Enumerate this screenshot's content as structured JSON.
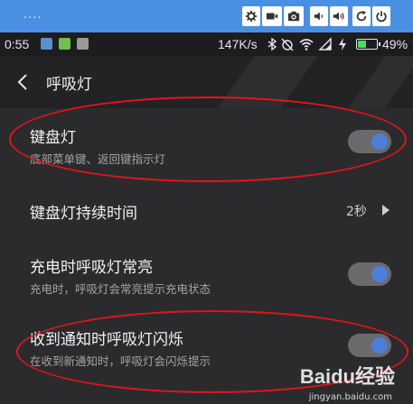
{
  "emulator": {
    "label": "....",
    "buttons": [
      "gear-icon",
      "video-icon",
      "camera-icon",
      "volume-down-icon",
      "volume-up-icon",
      "refresh-icon",
      "power-icon"
    ]
  },
  "status_bar": {
    "time": "0:55",
    "speed": "147K/s",
    "battery_percent": "49%",
    "battery_level": 0.49
  },
  "header": {
    "title": "呼吸灯"
  },
  "settings": {
    "keyboard_light": {
      "title": "键盘灯",
      "subtitle": "底部菜单键、返回键指示灯",
      "enabled": true
    },
    "keyboard_duration": {
      "title": "键盘灯持续时间",
      "value": "2秒"
    },
    "charging_light": {
      "title": "充电时呼吸灯常亮",
      "subtitle": "充电时，呼吸灯会常亮提示充电状态",
      "enabled": true
    },
    "notification_light": {
      "title": "收到通知时呼吸灯闪烁",
      "subtitle": "在收到新通知时，呼吸灯会闪烁提示",
      "enabled": true
    }
  },
  "watermark": {
    "brand": "Baidu经验",
    "url": "jingyan.baidu.com"
  },
  "colors": {
    "toggle_knob": "#4d7ed9",
    "annotation": "#e3141a",
    "emulator_bar": "#4a90e2"
  }
}
